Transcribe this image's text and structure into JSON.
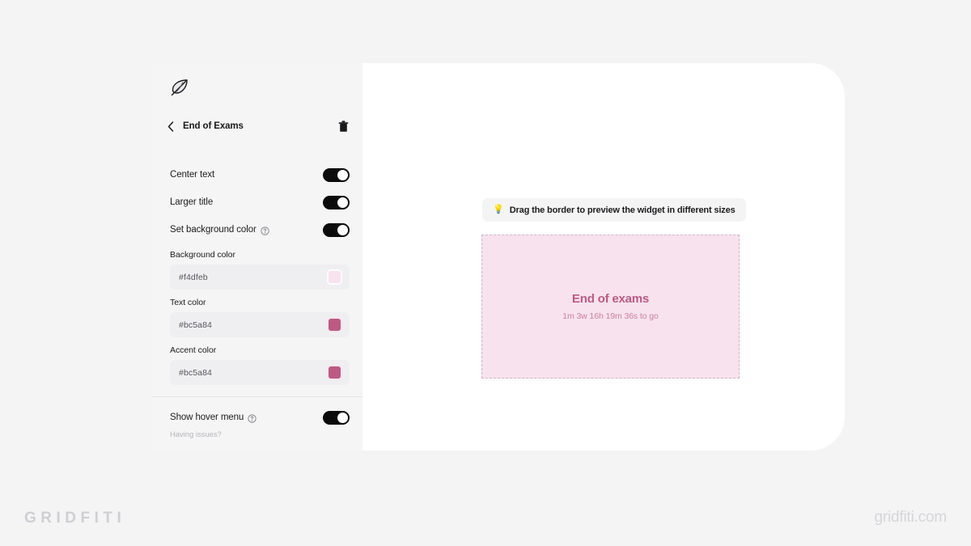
{
  "branding": {
    "left": "GRIDFITI",
    "right": "gridfiti.com"
  },
  "sidebar": {
    "logo_icon": "feather-icon",
    "header": {
      "back_icon": "chevron-left-icon",
      "title": "End of Exams",
      "delete_icon": "trash-icon"
    },
    "toggles": [
      {
        "label": "Center text",
        "enabled": true,
        "has_help": false
      },
      {
        "label": "Larger title",
        "enabled": true,
        "has_help": false
      },
      {
        "label": "Set background color",
        "enabled": true,
        "has_help": true
      }
    ],
    "colors": [
      {
        "label": "Background color",
        "value": "#f4dfeb",
        "swatch": "#f7e2ee"
      },
      {
        "label": "Text color",
        "value": "#bc5a84",
        "swatch": "#bc5a84"
      },
      {
        "label": "Accent color",
        "value": "#bc5a84",
        "swatch": "#bc5a84"
      }
    ],
    "hover_menu": {
      "label": "Show hover menu",
      "enabled": true,
      "has_help": true
    },
    "having_issues": "Having issues?"
  },
  "preview": {
    "hint": {
      "icon": "lightbulb-icon",
      "emoji": "💡",
      "text": "Drag the border to preview the widget in different sizes"
    },
    "widget": {
      "title": "End of exams",
      "countdown": "1m 3w 16h 19m 36s to go",
      "background": "#f7e2ee",
      "text_color": "#bc5a84",
      "accent_color": "#bc5a84"
    }
  }
}
